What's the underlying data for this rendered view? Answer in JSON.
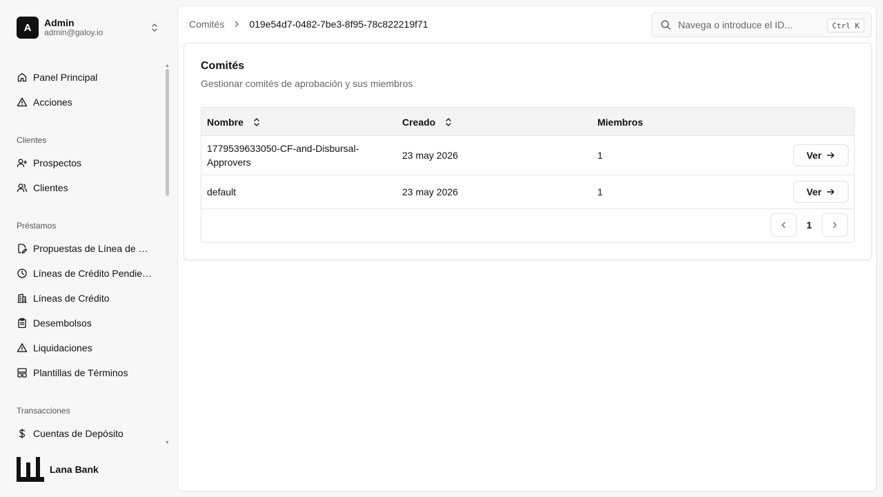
{
  "user": {
    "initial": "A",
    "name": "Admin",
    "email": "admin@galoy.io"
  },
  "nav": {
    "top": [
      {
        "label": "Panel Principal",
        "icon": "home-icon"
      },
      {
        "label": "Acciones",
        "icon": "alert-triangle-icon"
      }
    ],
    "groups": [
      {
        "title": "Clientes",
        "items": [
          {
            "label": "Prospectos",
            "icon": "user-plus-icon"
          },
          {
            "label": "Clientes",
            "icon": "users-icon"
          }
        ]
      },
      {
        "title": "Préstamos",
        "items": [
          {
            "label": "Propuestas de Línea de Cr...",
            "icon": "file-edit-icon"
          },
          {
            "label": "Líneas de Crédito Pendient...",
            "icon": "clock-icon"
          },
          {
            "label": "Líneas de Crédito",
            "icon": "building-icon"
          },
          {
            "label": "Desembolsos",
            "icon": "clipboard-icon"
          },
          {
            "label": "Liquidaciones",
            "icon": "alert-triangle-icon"
          },
          {
            "label": "Plantillas de Términos",
            "icon": "layout-template-icon"
          }
        ]
      },
      {
        "title": "Transacciones",
        "items": [
          {
            "label": "Cuentas de Depósito",
            "icon": "dollar-icon"
          }
        ]
      }
    ]
  },
  "brand": {
    "name": "Lana Bank"
  },
  "breadcrumb": {
    "root": "Comités",
    "current": "019e54d7-0482-7be3-8f95-78c822219f71"
  },
  "search": {
    "placeholder": "Navega o introduce el ID...",
    "value": "",
    "shortcut": "Ctrl K"
  },
  "card": {
    "title": "Comités",
    "description": "Gestionar comités de aprobación y sus miembros"
  },
  "table": {
    "headers": {
      "name": "Nombre",
      "created": "Creado",
      "members": "Miembros"
    },
    "rows": [
      {
        "name_line1": "1779539633050-CF-and-Disbursal-",
        "name_line2": "Approvers",
        "created": "23 may 2026",
        "members": "1",
        "action": "Ver"
      },
      {
        "name_line1": "default",
        "name_line2": "",
        "created": "23 may 2026",
        "members": "1",
        "action": "Ver"
      }
    ],
    "pagination": {
      "current_page": "1"
    }
  },
  "colors": {
    "accent": "#111111",
    "background": "#f7f7f8",
    "border": "#e5e5e7",
    "muted_text": "#666666"
  }
}
